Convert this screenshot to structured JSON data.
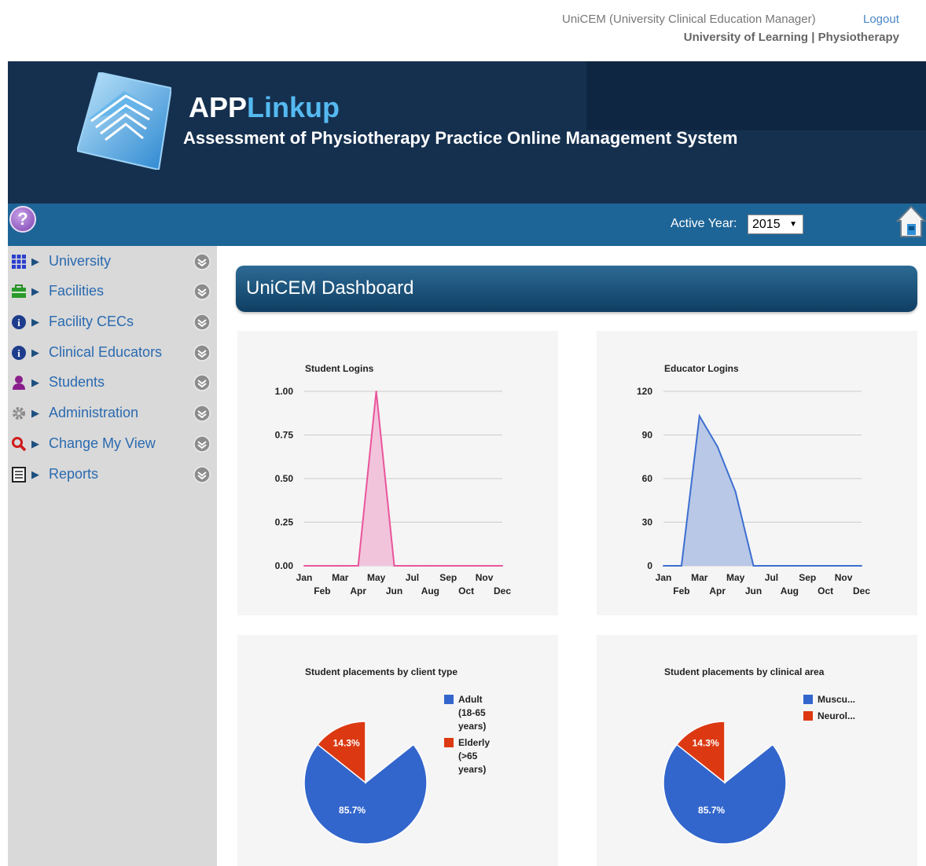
{
  "header": {
    "app_name": "UniCEM (University Clinical Education Manager)",
    "logout": "Logout",
    "org": "University of Learning | Physiotherapy"
  },
  "banner": {
    "brand_part1": "APP",
    "brand_part2": "Linkup",
    "tagline": "Assessment of Physiotherapy Practice Online Management System"
  },
  "toolbar": {
    "help": "?",
    "active_year_label": "Active Year:",
    "active_year": "2015"
  },
  "sidebar": {
    "items": [
      {
        "label": "University",
        "icon": "grid-icon"
      },
      {
        "label": "Facilities",
        "icon": "briefcase-icon"
      },
      {
        "label": "Facility CECs",
        "icon": "info-icon"
      },
      {
        "label": "Clinical Educators",
        "icon": "info-icon"
      },
      {
        "label": "Students",
        "icon": "person-icon"
      },
      {
        "label": "Administration",
        "icon": "gear-icon"
      },
      {
        "label": "Change My View",
        "icon": "magnifier-icon"
      },
      {
        "label": "Reports",
        "icon": "report-icon"
      }
    ]
  },
  "dashboard": {
    "title": "UniCEM Dashboard"
  },
  "chart_data": [
    {
      "type": "area",
      "title": "Student Logins",
      "categories": [
        "Jan",
        "Feb",
        "Mar",
        "Apr",
        "May",
        "Jun",
        "Jul",
        "Aug",
        "Sep",
        "Oct",
        "Nov",
        "Dec"
      ],
      "values": [
        0,
        0,
        0,
        0,
        1,
        0,
        0,
        0,
        0,
        0,
        0,
        0
      ],
      "ylim": [
        0,
        1
      ],
      "yticks": [
        "0.00",
        "0.25",
        "0.50",
        "0.75",
        "1.00"
      ],
      "grid": true,
      "color": "#e9559b",
      "fill": "#f2c4dc"
    },
    {
      "type": "area",
      "title": "Educator Logins",
      "categories": [
        "Jan",
        "Feb",
        "Mar",
        "Apr",
        "May",
        "Jun",
        "Jul",
        "Aug",
        "Sep",
        "Oct",
        "Nov",
        "Dec"
      ],
      "values": [
        0,
        0,
        103,
        82,
        51,
        0,
        0,
        0,
        0,
        0,
        0,
        0
      ],
      "ylim": [
        0,
        120
      ],
      "yticks": [
        "0",
        "30",
        "60",
        "90",
        "120"
      ],
      "grid": true,
      "color": "#3c6fd1",
      "fill": "#b9c8e6"
    },
    {
      "type": "pie",
      "title": "Student placements by client type",
      "slices": [
        {
          "label": "Adult (18-65 years)",
          "legend_lines": [
            "Adult",
            "(18-65",
            "years)"
          ],
          "value": 85.7,
          "pct_label": "85.7%",
          "color": "#3366cc"
        },
        {
          "label": "Elderly (>65 years)",
          "legend_lines": [
            "Elderly",
            "(>65",
            "years)"
          ],
          "value": 14.3,
          "pct_label": "14.3%",
          "color": "#dc3912"
        }
      ],
      "legend": "right"
    },
    {
      "type": "pie",
      "title": "Student placements by clinical area",
      "slices": [
        {
          "label": "Muscu...",
          "legend_lines": [
            "Muscu..."
          ],
          "value": 85.7,
          "pct_label": "85.7%",
          "color": "#3366cc"
        },
        {
          "label": "Neurol...",
          "legend_lines": [
            "Neurol..."
          ],
          "value": 14.3,
          "pct_label": "14.3%",
          "color": "#dc3912"
        }
      ],
      "legend": "right"
    }
  ]
}
